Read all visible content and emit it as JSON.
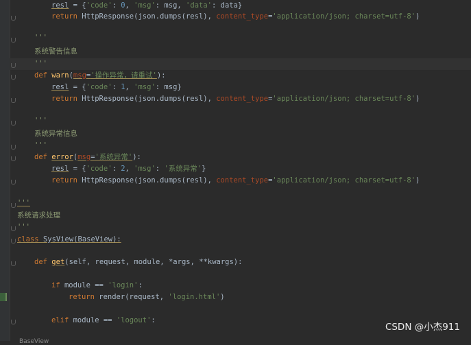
{
  "lines": [
    {
      "indent": "resl",
      "t": [
        [
          "",
          ""
        ]
      ]
    }
  ],
  "code": {
    "l1": [
      "resl",
      " = {",
      "'code'",
      ": ",
      "0",
      ", ",
      "'msg'",
      ": msg, ",
      "'data'",
      ": data}"
    ],
    "l2": [
      "return ",
      "HttpResponse(json.dumps(resl), ",
      "content_type",
      "=",
      "'application/json; charset=utf-8'",
      ")"
    ],
    "l3": "'''",
    "l4": "系统警告信息",
    "l5": "'''",
    "l6": [
      "def ",
      "warn",
      "(",
      "msg",
      "=",
      "'操作异常，请重试'",
      "):"
    ],
    "l7": [
      "resl",
      " = {",
      "'code'",
      ": ",
      "1",
      ", ",
      "'msg'",
      ": msg}"
    ],
    "l8": [
      "return ",
      "HttpResponse(json.dumps(resl), ",
      "content_type",
      "=",
      "'application/json; charset=utf-8'",
      ")"
    ],
    "l9": "'''",
    "l10": "系统异常信息",
    "l11": "'''",
    "l12": [
      "def ",
      "error",
      "(",
      "msg",
      "=",
      "'系统异常'",
      "):"
    ],
    "l13": [
      "resl",
      " = {",
      "'code'",
      ": ",
      "2",
      ", ",
      "'msg'",
      ": ",
      "'系统异常'",
      "}"
    ],
    "l14": [
      "return ",
      "HttpResponse(json.dumps(resl), ",
      "content_type",
      "=",
      "'application/json; charset=utf-8'",
      ")"
    ],
    "l15": "'''",
    "l16": "系统请求处理",
    "l17": "'''",
    "l18": [
      "class ",
      "SysView(BaseView):"
    ],
    "l19": [
      "def ",
      "get",
      "(self, request, module, *args, **kwargs):"
    ],
    "l20": [
      "if ",
      "module == ",
      "'login'",
      ":"
    ],
    "l21": [
      "return ",
      "render(request, ",
      "'login.html'",
      ")"
    ],
    "l22": [
      "elif ",
      "module == ",
      "'logout'",
      ":"
    ]
  },
  "watermark": "CSDN @小杰911",
  "footer": "BaseView"
}
